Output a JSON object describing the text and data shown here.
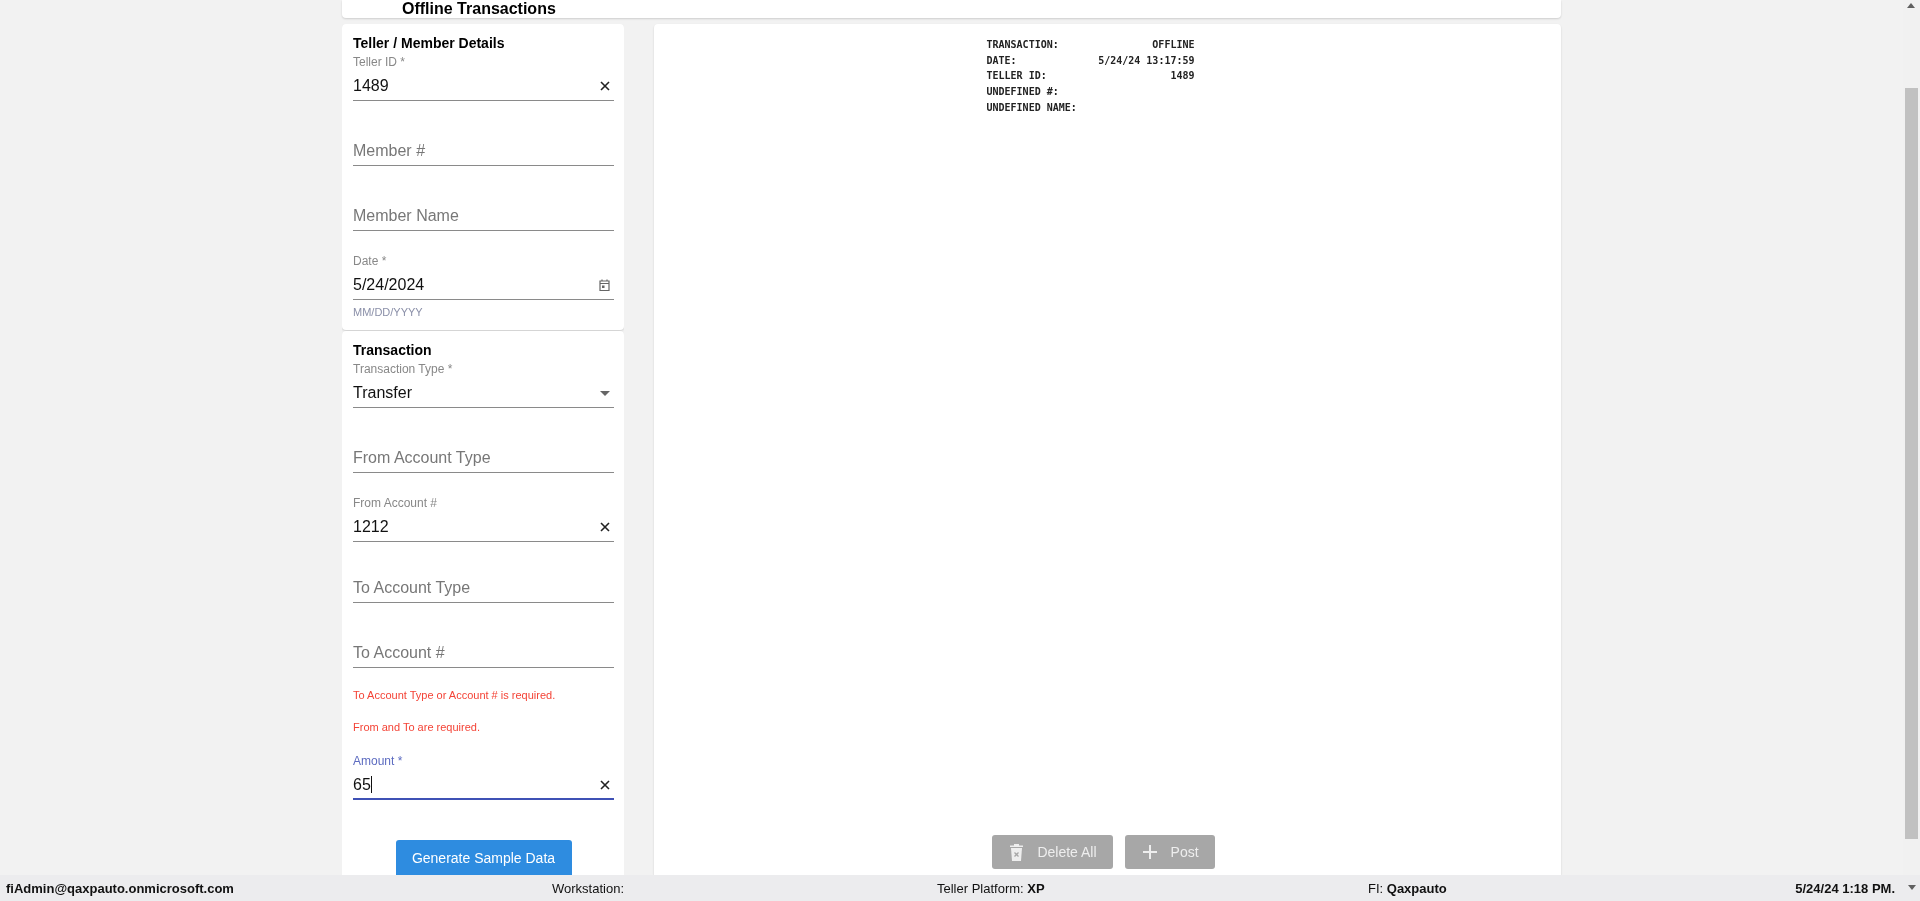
{
  "page_title": "Offline Transactions",
  "cards": [
    {
      "title": "Teller / Member Details",
      "fields": [
        {
          "kind": "text",
          "label": "Teller ID *",
          "value": "1489",
          "clearable": true,
          "focused": false
        },
        {
          "kind": "text",
          "placeholder": "Member #",
          "clearable": false,
          "focused": false
        },
        {
          "kind": "text",
          "placeholder": "Member Name",
          "clearable": false,
          "focused": false
        },
        {
          "kind": "date",
          "label": "Date *",
          "value": "5/24/2024",
          "helper": "MM/DD/YYYY",
          "clearable": false,
          "focused": false
        }
      ]
    },
    {
      "title": "Transaction",
      "fields": [
        {
          "kind": "select",
          "label": "Transaction Type *",
          "value": "Transfer",
          "clearable": false,
          "focused": false
        },
        {
          "kind": "text",
          "placeholder": "From Account Type",
          "clearable": false,
          "focused": false
        },
        {
          "kind": "text",
          "label": "From Account #",
          "value": "1212",
          "clearable": true,
          "focused": false
        },
        {
          "kind": "text",
          "placeholder": "To Account Type",
          "clearable": false,
          "focused": false
        },
        {
          "kind": "text",
          "placeholder": "To Account #",
          "clearable": false,
          "focused": false,
          "errors": [
            "To Account Type or Account # is required.",
            "From and To are required."
          ]
        },
        {
          "kind": "text",
          "label": "Amount *",
          "value": "65",
          "clearable": true,
          "focused": true
        }
      ],
      "button": {
        "label": "Generate Sample Data"
      }
    }
  ],
  "receipt": [
    {
      "key": "TRANSACTION:",
      "value": "OFFLINE"
    },
    {
      "key": "DATE:",
      "value": "5/24/24 13:17:59"
    },
    {
      "key": "TELLER ID:",
      "value": "1489"
    },
    {
      "key": "UNDEFINED #:"
    },
    {
      "key": "UNDEFINED NAME:"
    }
  ],
  "actions": [
    {
      "kind": "delete",
      "label": "Delete All",
      "disabled": true
    },
    {
      "kind": "add",
      "label": "Post",
      "disabled": true
    }
  ],
  "status_bar": {
    "user": "fiAdmin@qaxpauto.onmicrosoft.com",
    "workstation": "Workstation:",
    "platform": "Teller Platform: **XP**",
    "fi": "FI: **Qaxpauto**",
    "datetime": "5/24/24 1:18 PM."
  }
}
